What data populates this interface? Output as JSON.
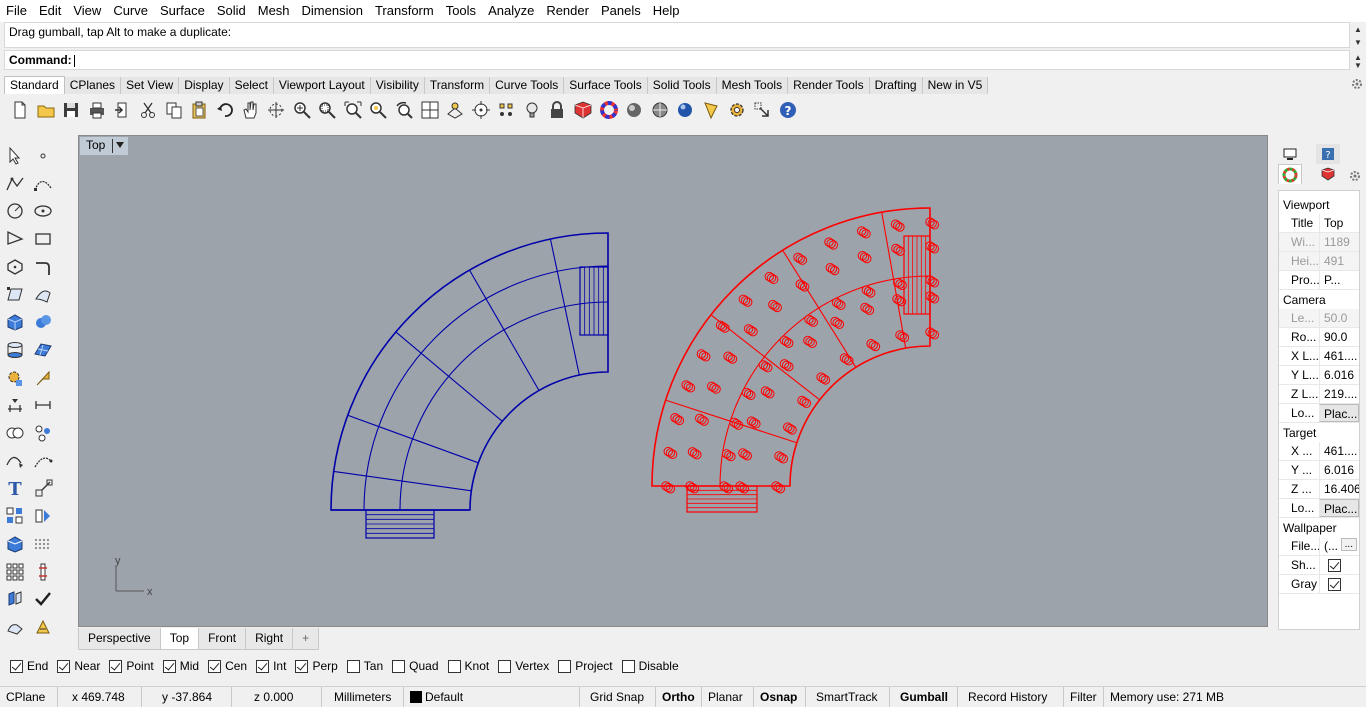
{
  "menu": [
    "File",
    "Edit",
    "View",
    "Curve",
    "Surface",
    "Solid",
    "Mesh",
    "Dimension",
    "Transform",
    "Tools",
    "Analyze",
    "Render",
    "Panels",
    "Help"
  ],
  "command": {
    "history": "Drag gumball, tap Alt to make a duplicate:",
    "prompt": "Command:"
  },
  "toolbar_tabs": [
    "Standard",
    "CPlanes",
    "Set View",
    "Display",
    "Select",
    "Viewport Layout",
    "Visibility",
    "Transform",
    "Curve Tools",
    "Surface Tools",
    "Solid Tools",
    "Mesh Tools",
    "Render Tools",
    "Drafting",
    "New in V5"
  ],
  "toolbar_icons": [
    "new-icon",
    "open-icon",
    "save-icon",
    "print-icon",
    "import-icon",
    "cut-icon",
    "copy-icon",
    "paste-icon",
    "undo-icon",
    "pan-icon",
    "rotate-view-icon",
    "zoom-icon",
    "zoom-window-icon",
    "zoom-extents-icon",
    "zoom-selected-icon",
    "undo-view-icon",
    "four-viewports-icon",
    "options-icon",
    "select-icon",
    "point-grid-icon",
    "light-icon",
    "lock-icon",
    "material-icon",
    "color-wheel-icon",
    "sphere-grey-icon",
    "sphere-check-icon",
    "sphere-blue-icon",
    "flag-icon",
    "gear-icon",
    "transform-icon",
    "help-icon"
  ],
  "viewport": {
    "title": "Top",
    "axis_y": "y",
    "axis_x": "x",
    "colors": {
      "left_object": "#0000aa",
      "right_object": "#ff0000",
      "background": "#9da3ab"
    }
  },
  "viewport_tabs": [
    "Perspective",
    "Top",
    "Front",
    "Right"
  ],
  "osnap": [
    {
      "label": "End",
      "checked": true
    },
    {
      "label": "Near",
      "checked": true
    },
    {
      "label": "Point",
      "checked": true
    },
    {
      "label": "Mid",
      "checked": true
    },
    {
      "label": "Cen",
      "checked": true
    },
    {
      "label": "Int",
      "checked": true
    },
    {
      "label": "Perp",
      "checked": true
    },
    {
      "label": "Tan",
      "checked": false
    },
    {
      "label": "Quad",
      "checked": false
    },
    {
      "label": "Knot",
      "checked": false
    },
    {
      "label": "Vertex",
      "checked": false
    },
    {
      "label": "Project",
      "checked": false
    },
    {
      "label": "Disable",
      "checked": false
    }
  ],
  "status": {
    "cplane": "CPlane",
    "x": "x 469.748",
    "y": "y -37.864",
    "z": "z 0.000",
    "units": "Millimeters",
    "layer": "Default",
    "grid_snap": "Grid Snap",
    "ortho": "Ortho",
    "planar": "Planar",
    "osnap": "Osnap",
    "smarttrack": "SmartTrack",
    "gumball": "Gumball",
    "record_history": "Record History",
    "filter": "Filter",
    "memory": "Memory use: 271 MB"
  },
  "properties": {
    "viewport_header": "Viewport",
    "rows_viewport": [
      {
        "k": "Title",
        "v": "Top",
        "dim": false
      },
      {
        "k": "Wi...",
        "v": "1189",
        "dim": true
      },
      {
        "k": "Hei...",
        "v": "491",
        "dim": true
      },
      {
        "k": "Pro...",
        "v": "P...",
        "dim": false
      }
    ],
    "camera_header": "Camera",
    "rows_camera": [
      {
        "k": "Le...",
        "v": "50.0",
        "dim": true
      },
      {
        "k": "Ro...",
        "v": "90.0",
        "dim": false
      },
      {
        "k": "X L...",
        "v": "461....",
        "dim": false
      },
      {
        "k": "Y L...",
        "v": "6.016",
        "dim": false
      },
      {
        "k": "Z L...",
        "v": "219....",
        "dim": false
      },
      {
        "k": "Lo...",
        "v": "Plac...",
        "dim": false
      }
    ],
    "target_header": "Target",
    "rows_target": [
      {
        "k": "X ...",
        "v": "461....",
        "dim": false
      },
      {
        "k": "Y ...",
        "v": "6.016",
        "dim": false
      },
      {
        "k": "Z ...",
        "v": "16.406",
        "dim": false
      },
      {
        "k": "Lo...",
        "v": "Plac...",
        "dim": false
      }
    ],
    "wallpaper_header": "Wallpaper",
    "rows_wallpaper": [
      {
        "k": "File...",
        "v": "(...",
        "dim": false
      },
      {
        "k": "Sh...",
        "v": "",
        "dim": false
      },
      {
        "k": "Gray",
        "v": "",
        "dim": false
      }
    ],
    "more_button": "..."
  }
}
